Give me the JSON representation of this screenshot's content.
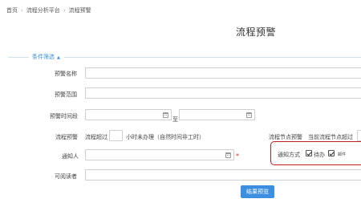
{
  "breadcrumb": [
    "首页",
    "流程分析平台",
    "流程预警"
  ],
  "page_title": "流程预警",
  "filter": {
    "label": "条件筛选",
    "caret": "▲"
  },
  "fields": {
    "warning_name": {
      "label": "预警名称",
      "value": ""
    },
    "warning_scope": {
      "label": "预警范围",
      "value": ""
    },
    "warning_period": {
      "label": "预警时间段",
      "start": "",
      "end": "",
      "to": "至"
    },
    "process_warning": {
      "label": "流程预警",
      "prefix": "流程超过",
      "value": "",
      "suffix": "小时未办理（自然时间非工时）"
    },
    "node_warning": {
      "label": "流程节点预警",
      "prefix": "当前流程节点超过"
    },
    "notify_person": {
      "label": "通知人",
      "value": "",
      "required": "*"
    },
    "notify_method": {
      "label": "通知方式",
      "options": [
        {
          "label": "待办",
          "checked": true
        },
        {
          "label": "邮件",
          "checked": true
        }
      ]
    },
    "readers": {
      "label": "可阅读者",
      "value": ""
    }
  },
  "button": {
    "label": "结果预览",
    "color": "#3c8fe0"
  },
  "colors": {
    "accent": "#3a8fd8",
    "highlight_border": "#c21d1d",
    "required": "#d9262b"
  },
  "icons": [
    "calendar-icon",
    "calendar-icon",
    "address-book-icon",
    "checkbox-checked-icon"
  ]
}
